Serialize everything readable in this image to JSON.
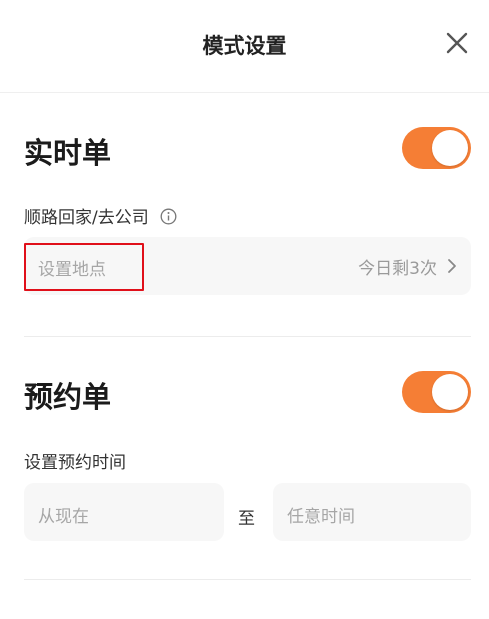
{
  "header": {
    "title": "模式设置"
  },
  "realtime": {
    "title": "实时单",
    "toggle_on": true,
    "route_label": "顺路回家/去公司",
    "location_placeholder": "设置地点",
    "remaining_text": "今日剩3次"
  },
  "reservation": {
    "title": "预约单",
    "toggle_on": true,
    "time_label": "设置预约时间",
    "from_placeholder": "从现在",
    "to_text": "至",
    "to_placeholder": "任意时间"
  },
  "colors": {
    "accent": "#f57e35",
    "highlight": "#e0101a"
  },
  "icons": [
    "close-icon",
    "info-icon",
    "chevron-right-icon"
  ]
}
